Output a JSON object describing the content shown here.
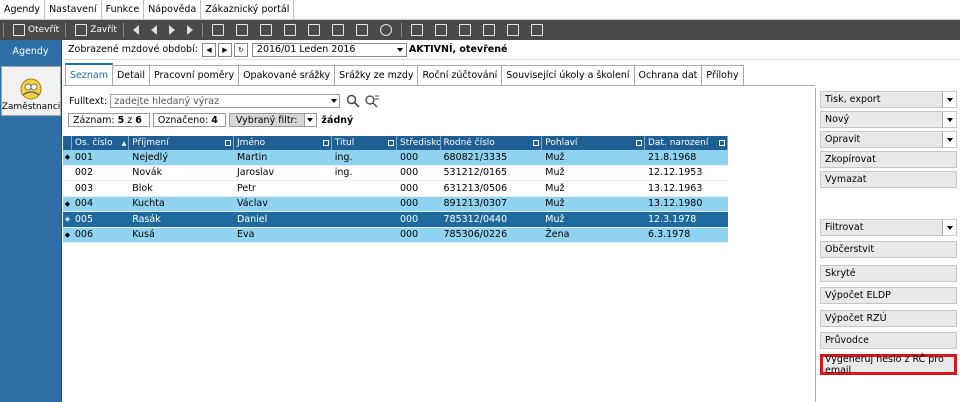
{
  "menu": [
    "Agendy",
    "Nastavení",
    "Funkce",
    "Nápověda",
    "Zákaznický portál"
  ],
  "toolbar": {
    "open_label": "Otevřít",
    "close_label": "Zavřít"
  },
  "sidebar": {
    "title": "Agendy",
    "card_label": "Zaměstnanci"
  },
  "period": {
    "label": "Zobrazené mzdové období:",
    "value": "2016/01 Leden 2016",
    "status": "AKTIVNÍ, otevřené"
  },
  "tabs": [
    "Seznam",
    "Detail",
    "Pracovní poměry",
    "Opakované srážky",
    "Srážky ze mzdy",
    "Roční zúčtování",
    "Související úkoly a školení",
    "Ochrana dat",
    "Přílohy"
  ],
  "search": {
    "label": "Fulltext:",
    "placeholder": "zadejte hledaný výraz"
  },
  "counts": {
    "record_label": "Záznam:",
    "record_current": "5",
    "record_of": "z",
    "record_total": "6",
    "marked_label": "Označeno:",
    "marked_value": "4",
    "filter_label": "Vybraný filtr:",
    "filter_value": "žádný"
  },
  "grid": {
    "columns": [
      "Os. číslo",
      "Příjmení",
      "Jméno",
      "Titul",
      "Středisko",
      "Rodné číslo",
      "Pohlaví",
      "Dat. narození"
    ],
    "rows": [
      {
        "marker": "◆",
        "cells": [
          "001",
          "Nejedlý",
          "Martin",
          "ing.",
          "000",
          "680821/3335",
          "Muž",
          "21.8.1968"
        ],
        "state": "marked"
      },
      {
        "marker": "",
        "cells": [
          "002",
          "Novák",
          "Jaroslav",
          "ing.",
          "000",
          "531212/0165",
          "Muž",
          "12.12.1953"
        ],
        "state": "normal"
      },
      {
        "marker": "",
        "cells": [
          "003",
          "Blok",
          "Petr",
          "",
          "000",
          "631213/0506",
          "Muž",
          "13.12.1963"
        ],
        "state": "normal"
      },
      {
        "marker": "◆",
        "cells": [
          "004",
          "Kuchta",
          "Václav",
          "",
          "000",
          "891213/0307",
          "Muž",
          "13.12.1980"
        ],
        "state": "marked"
      },
      {
        "marker": "◈",
        "cells": [
          "005",
          "Rasák",
          "Daniel",
          "",
          "000",
          "785312/0440",
          "Muž",
          "12.3.1978"
        ],
        "state": "selected"
      },
      {
        "marker": "◆",
        "cells": [
          "006",
          "Kusá",
          "Eva",
          "",
          "000",
          "785306/0226",
          "Žena",
          "6.3.1978"
        ],
        "state": "marked"
      }
    ]
  },
  "actions": [
    {
      "label": "Tisk, export",
      "dropdown": true
    },
    {
      "label": "Nový",
      "dropdown": true
    },
    {
      "label": "Opravit",
      "dropdown": true
    },
    {
      "label": "Zkopírovat",
      "dropdown": false
    },
    {
      "label": "Vymazat",
      "dropdown": false
    },
    {
      "label": "Filtrovat",
      "dropdown": true
    },
    {
      "label": "Občerstvit",
      "dropdown": false
    },
    {
      "label": "Skryté",
      "dropdown": false
    },
    {
      "label": "Výpočet ELDP",
      "dropdown": false
    },
    {
      "label": "Výpočet RZÚ",
      "dropdown": false
    },
    {
      "label": "Průvodce",
      "dropdown": false
    },
    {
      "label": "Vygeneruj heslo z RČ pro email",
      "dropdown": false,
      "highlighted": true
    }
  ],
  "colors": {
    "header_bg": "#1f5f93",
    "marked_row": "#8fd3f0",
    "selected_row": "#1e6a9e",
    "highlight_border": "#d8141c",
    "sidebar_bg": "#2f6fa8"
  }
}
